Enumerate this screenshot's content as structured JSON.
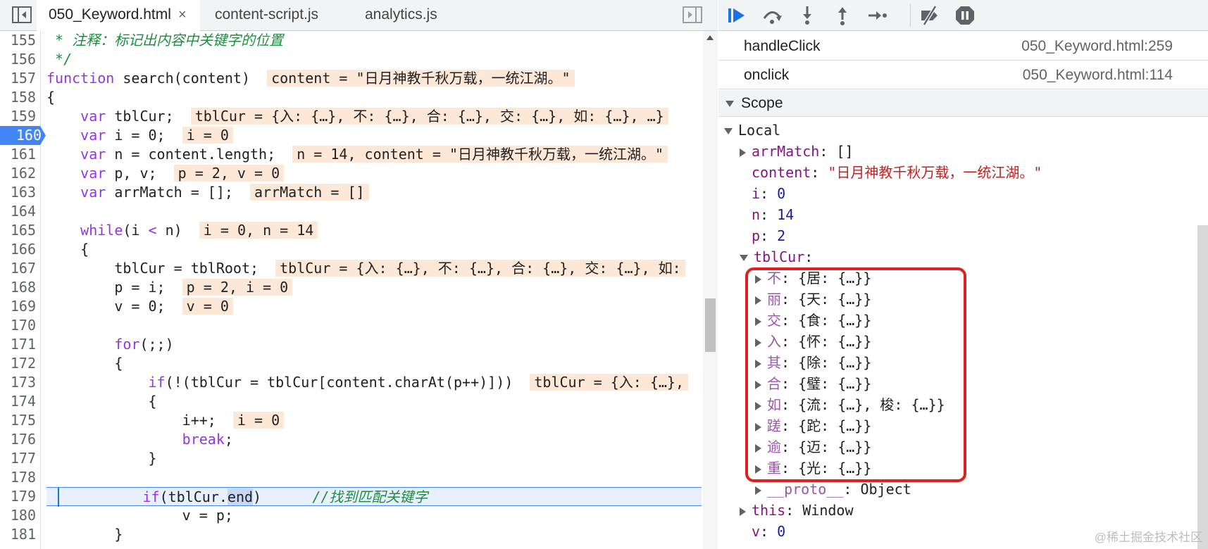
{
  "tabs": [
    {
      "label": "050_Keyword.html",
      "active": true
    },
    {
      "label": "content-script.js",
      "active": false
    },
    {
      "label": "analytics.js",
      "active": false
    }
  ],
  "tab_close_glyph": "×",
  "editor": {
    "line_numbers": [
      "155",
      "156",
      "157",
      "158",
      "159",
      "160",
      "161",
      "162",
      "163",
      "164",
      "165",
      "166",
      "167",
      "168",
      "169",
      "170",
      "171",
      "172",
      "173",
      "174",
      "175",
      "176",
      "177",
      "178",
      "179",
      "180",
      "181"
    ],
    "breakpoint_line": "160",
    "inline_values": {
      "l157": "content = \"日月神教千秋万载，一统江湖。\"",
      "l159": "tblCur = {入: {…}, 不: {…}, 合: {…}, 交: {…}, 如: {…}, …}",
      "l160": "i = 0",
      "l161": "n = 14, content = \"日月神教千秋万载，一统江湖。\"",
      "l162": "p = 2, v = 0",
      "l163": "arrMatch = []",
      "l165": "i = 0, n = 14",
      "l167": "tblCur = {入: {…}, 不: {…}, 合: {…}, 交: {…}, 如:",
      "l168": "p = 2, i = 0",
      "l169": "v = 0",
      "l173": "tblCur = {入: {…},",
      "l175": "i = 0"
    }
  },
  "call_stack": [
    {
      "fn": "handleClick",
      "location": "050_Keyword.html:259"
    },
    {
      "fn": "onclick",
      "location": "050_Keyword.html:114"
    }
  ],
  "scope": {
    "header": "Scope",
    "local_label": "Local",
    "arrMatch": {
      "key": "arrMatch",
      "value": "[]"
    },
    "content": {
      "key": "content",
      "value": "\"日月神教千秋万载，一统江湖。\""
    },
    "i": {
      "key": "i",
      "value": "0"
    },
    "n": {
      "key": "n",
      "value": "14"
    },
    "p": {
      "key": "p",
      "value": "2"
    },
    "tblCur_key": "tblCur",
    "tblCur_entries": [
      {
        "key": "不",
        "value": "{居: {…}}"
      },
      {
        "key": "丽",
        "value": "{天: {…}}"
      },
      {
        "key": "交",
        "value": "{食: {…}}"
      },
      {
        "key": "入",
        "value": "{怀: {…}}"
      },
      {
        "key": "其",
        "value": "{除: {…}}"
      },
      {
        "key": "合",
        "value": "{璧: {…}}"
      },
      {
        "key": "如",
        "value": "{流: {…}, 梭: {…}}"
      },
      {
        "key": "蹉",
        "value": "{跎: {…}}"
      },
      {
        "key": "逾",
        "value": "{迈: {…}}"
      },
      {
        "key": "重",
        "value": "{光: {…}}"
      }
    ],
    "proto": {
      "key": "__proto__",
      "value": "Object"
    },
    "this": {
      "key": "this",
      "value": "Window"
    },
    "v": {
      "key": "v",
      "value": "0"
    }
  },
  "watermark": "@稀土掘金技术社区",
  "colors": {
    "highlight_box": "#e02020",
    "breakpoint": "#4285f4",
    "inline_value_bg": "#fde8d7"
  }
}
